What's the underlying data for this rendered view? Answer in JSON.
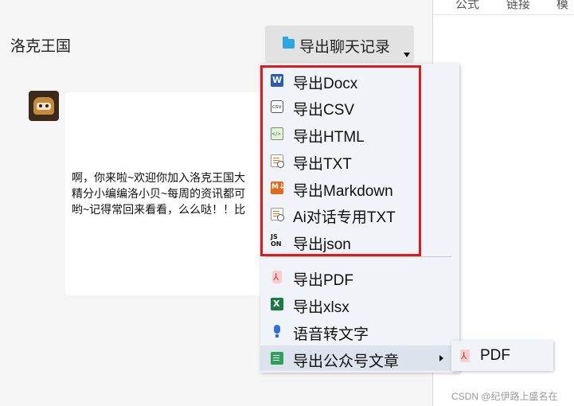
{
  "chat": {
    "title": "洛克王国",
    "export_button_label": "导出聊天记录",
    "message_lines": "啊，你来啦~欢迎你加入洛克王国大\n精分小编编洛小贝~每周的资讯都可\n哟~记得常回来看看，么么哒！！比"
  },
  "export_menu": {
    "items": [
      {
        "label": "导出Docx",
        "icon": "word-docx-icon"
      },
      {
        "label": "导出CSV",
        "icon": "csv-file-icon"
      },
      {
        "label": "导出HTML",
        "icon": "html-file-icon"
      },
      {
        "label": "导出TXT",
        "icon": "txt-file-icon"
      },
      {
        "label": "导出Markdown",
        "icon": "markdown-icon"
      },
      {
        "label": "Ai对话专用TXT",
        "icon": "txt-file-icon"
      },
      {
        "label": "导出json",
        "icon": "json-icon"
      },
      {
        "label": "导出PDF",
        "icon": "pdf-icon"
      },
      {
        "label": "导出xlsx",
        "icon": "excel-xlsx-icon"
      },
      {
        "label": "语音转文字",
        "icon": "microphone-icon"
      },
      {
        "label": "导出公众号文章",
        "icon": "article-icon"
      }
    ],
    "submenu": {
      "label": "PDF",
      "icon": "pdf-icon"
    }
  },
  "right_pane": {
    "tabs": [
      "公式",
      "链接",
      "模"
    ]
  },
  "watermark": "CSDN @纪伊路上盛名在",
  "colors": {
    "highlight_border": "#e31818",
    "menu_background": "#f0f3f8",
    "chat_background": "#f5f5f5"
  }
}
